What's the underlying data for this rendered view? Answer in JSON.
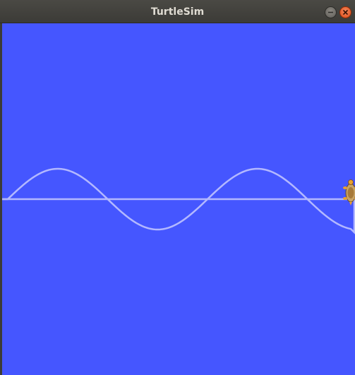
{
  "window": {
    "title": "TurtleSim",
    "buttons": {
      "minimize_icon": "minimize-icon",
      "close_icon": "close-icon"
    }
  },
  "canvas": {
    "background_color": "#4556ff",
    "pen_color": "#b3b8ff",
    "turtle_icon": "turtle-icon"
  }
}
